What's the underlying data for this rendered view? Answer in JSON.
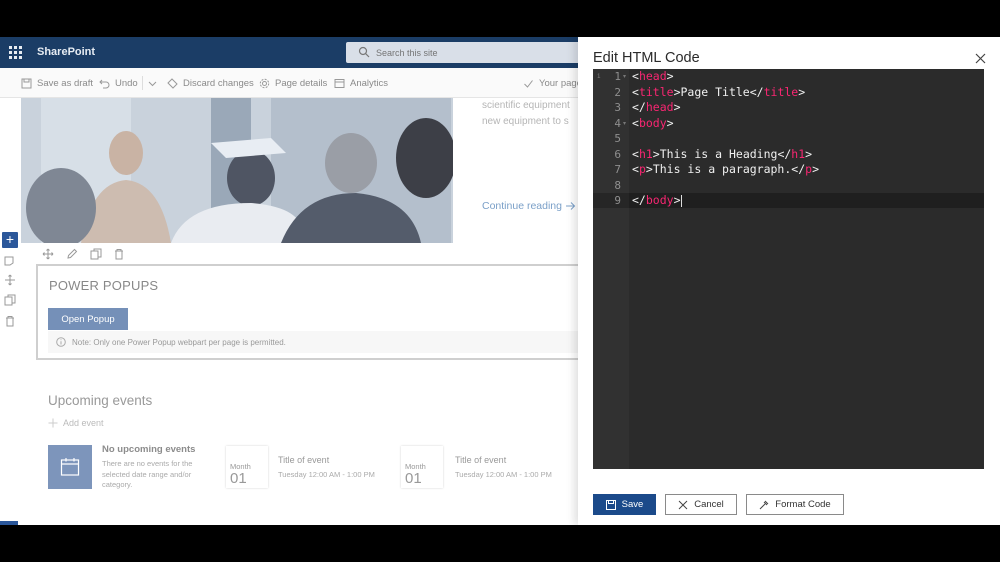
{
  "suite": {
    "app_name": "SharePoint",
    "search_placeholder": "Search this site"
  },
  "command_bar": {
    "save_draft": "Save as draft",
    "undo": "Undo",
    "discard": "Discard changes",
    "page_details": "Page details",
    "analytics": "Analytics",
    "your_page": "Your page"
  },
  "news": {
    "text_line1": "scientific equipment",
    "text_line2": "new equipment to s",
    "continue_reading": "Continue reading"
  },
  "popup_webpart": {
    "title": "POWER POPUPS",
    "open_button": "Open Popup",
    "note": "Note: Only one Power Popup webpart per page is permitted."
  },
  "events": {
    "title": "Upcoming events",
    "add_event": "Add event",
    "no_events_title": "No upcoming events",
    "no_events_desc": "There are no events for the selected date range and/or category.",
    "items": [
      {
        "month": "Month",
        "day": "01",
        "title": "Title of event",
        "time": "Tuesday 12:00 AM - 1:00 PM"
      },
      {
        "month": "Month",
        "day": "01",
        "title": "Title of event",
        "time": "Tuesday 12:00 AM - 1:00 PM"
      }
    ]
  },
  "panel": {
    "title": "Edit HTML Code",
    "line_numbers": [
      "1",
      "2",
      "3",
      "4",
      "5",
      "6",
      "7",
      "8",
      "9"
    ],
    "code_lines": [
      "<head>",
      "<title>Page Title</title>",
      "</head>",
      "<body>",
      "",
      "<h1>This is a Heading</h1>",
      "<p>This is a paragraph.</p>",
      "",
      "</body>"
    ],
    "save": "Save",
    "cancel": "Cancel",
    "format_code": "Format Code"
  },
  "colors": {
    "suite_bar": "#1b3d66",
    "primary": "#1b4a8a",
    "tag": "#f92672",
    "editor_bg": "#2b2b2b"
  },
  "icons": [
    "waffle-icon",
    "search-icon",
    "save-icon",
    "undo-icon",
    "chevron-down-icon",
    "discard-icon",
    "gear-icon",
    "analytics-icon",
    "check-icon",
    "arrow-right-icon",
    "move-icon",
    "edit-icon",
    "duplicate-icon",
    "delete-icon",
    "info-icon",
    "calendar-icon",
    "plus-icon",
    "close-icon",
    "format-icon"
  ]
}
